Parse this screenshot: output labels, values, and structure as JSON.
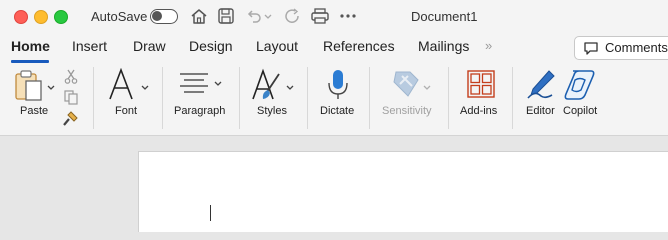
{
  "titlebar": {
    "autosave_label": "AutoSave",
    "autosave_on": false,
    "document_title": "Document1"
  },
  "tabs": [
    {
      "label": "Home",
      "active": true
    },
    {
      "label": "Insert"
    },
    {
      "label": "Draw"
    },
    {
      "label": "Design"
    },
    {
      "label": "Layout"
    },
    {
      "label": "References"
    },
    {
      "label": "Mailings"
    }
  ],
  "comments_label": "Comments",
  "ribbon": {
    "paste": "Paste",
    "font": "Font",
    "paragraph": "Paragraph",
    "styles": "Styles",
    "dictate": "Dictate",
    "sensitivity": "Sensitivity",
    "addins": "Add-ins",
    "editor": "Editor",
    "copilot": "Copilot"
  },
  "colors": {
    "accent": "#185abd",
    "addins_red": "#c43e1c",
    "dictate_blue": "#2b7cd3"
  }
}
